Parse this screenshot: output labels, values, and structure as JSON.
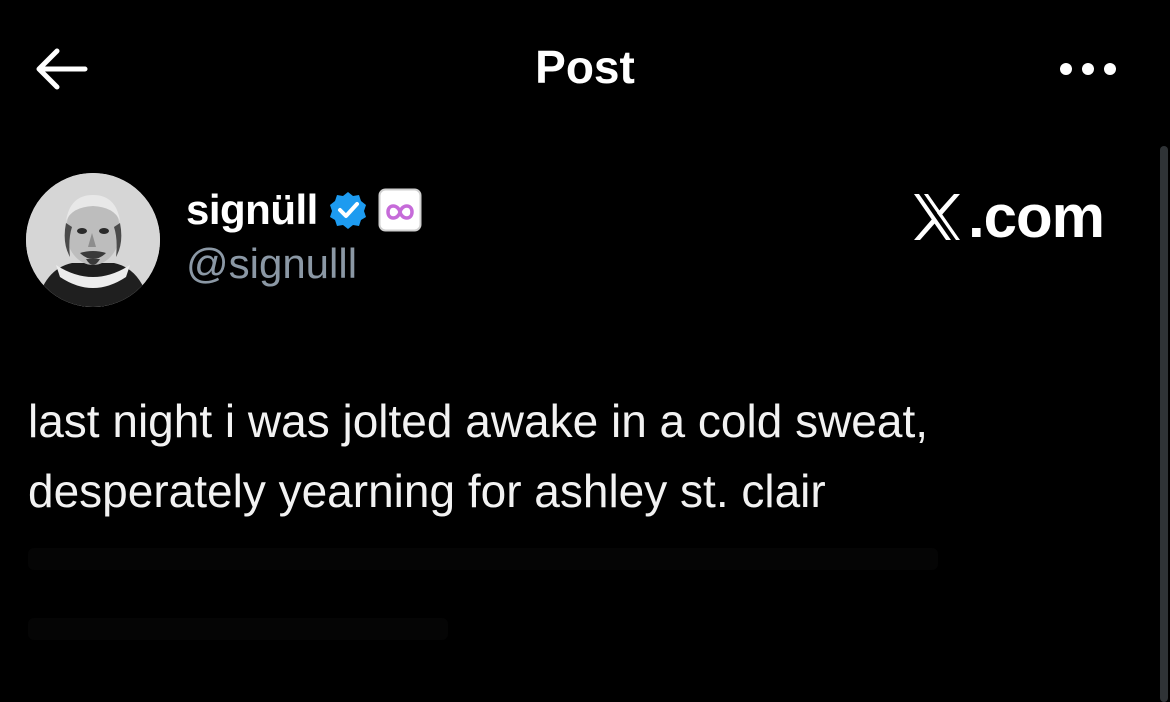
{
  "header": {
    "title": "Post",
    "back_icon": "arrow-left-icon",
    "more_icon": "more-horizontal-icon"
  },
  "author": {
    "display_name": "signüll",
    "handle": "@signulll",
    "verified_icon": "verified-badge-icon",
    "affiliation_icon": "affiliation-badge-icon"
  },
  "watermark": {
    "label": ".com"
  },
  "post": {
    "lines": [
      "last night i was jolted awake in a cold sweat,",
      "desperately yearning for ashley st. clair"
    ]
  },
  "colors": {
    "background": "#000000",
    "text": "#e7e9ea",
    "secondary": "#8b98a5",
    "verified": "#1d9bf0",
    "affiliation": "#c66bd9"
  }
}
